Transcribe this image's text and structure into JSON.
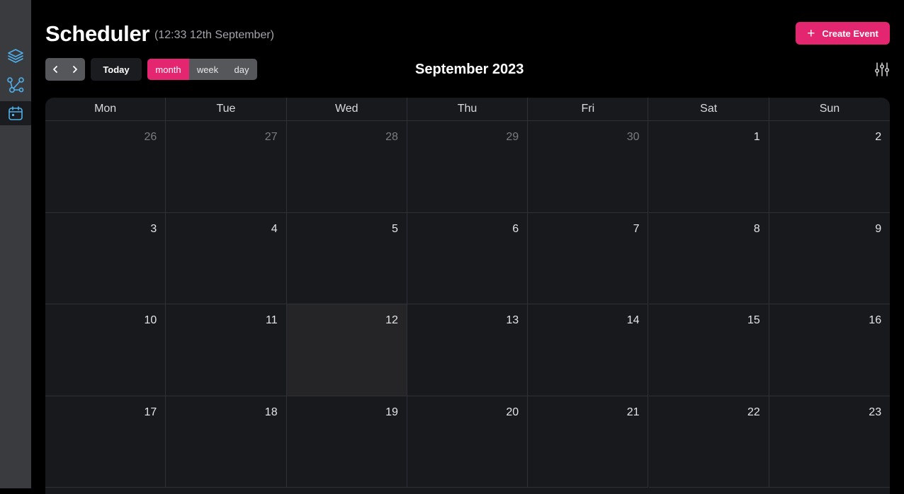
{
  "sidebar": {
    "items": [
      {
        "icon": "layers-icon",
        "active": false
      },
      {
        "icon": "workflow-icon",
        "active": false
      },
      {
        "icon": "calendar-icon",
        "active": true
      }
    ]
  },
  "header": {
    "title": "Scheduler",
    "subtitle": "(12:33 12th September)",
    "create_label": "Create Event"
  },
  "toolbar": {
    "prev_icon": "chevron-left-icon",
    "next_icon": "chevron-right-icon",
    "today_label": "Today",
    "views": [
      {
        "label": "month",
        "active": true
      },
      {
        "label": "week",
        "active": false
      },
      {
        "label": "day",
        "active": false
      }
    ],
    "month_title": "September 2023",
    "filter_icon": "sliders-icon"
  },
  "calendar": {
    "weekdays": [
      "Mon",
      "Tue",
      "Wed",
      "Thu",
      "Fri",
      "Sat",
      "Sun"
    ],
    "weeks": [
      [
        {
          "d": "26",
          "other": true
        },
        {
          "d": "27",
          "other": true
        },
        {
          "d": "28",
          "other": true
        },
        {
          "d": "29",
          "other": true
        },
        {
          "d": "30",
          "other": true
        },
        {
          "d": "1"
        },
        {
          "d": "2"
        }
      ],
      [
        {
          "d": "3"
        },
        {
          "d": "4"
        },
        {
          "d": "5"
        },
        {
          "d": "6"
        },
        {
          "d": "7"
        },
        {
          "d": "8"
        },
        {
          "d": "9"
        }
      ],
      [
        {
          "d": "10"
        },
        {
          "d": "11"
        },
        {
          "d": "12",
          "today": true
        },
        {
          "d": "13"
        },
        {
          "d": "14"
        },
        {
          "d": "15"
        },
        {
          "d": "16"
        }
      ],
      [
        {
          "d": "17"
        },
        {
          "d": "18"
        },
        {
          "d": "19"
        },
        {
          "d": "20"
        },
        {
          "d": "21"
        },
        {
          "d": "22"
        },
        {
          "d": "23"
        }
      ]
    ]
  },
  "colors": {
    "accent": "#e3266f",
    "sidebar_icon": "#4fb0ec",
    "cell_bg": "#18191d",
    "today_bg": "#252527"
  }
}
